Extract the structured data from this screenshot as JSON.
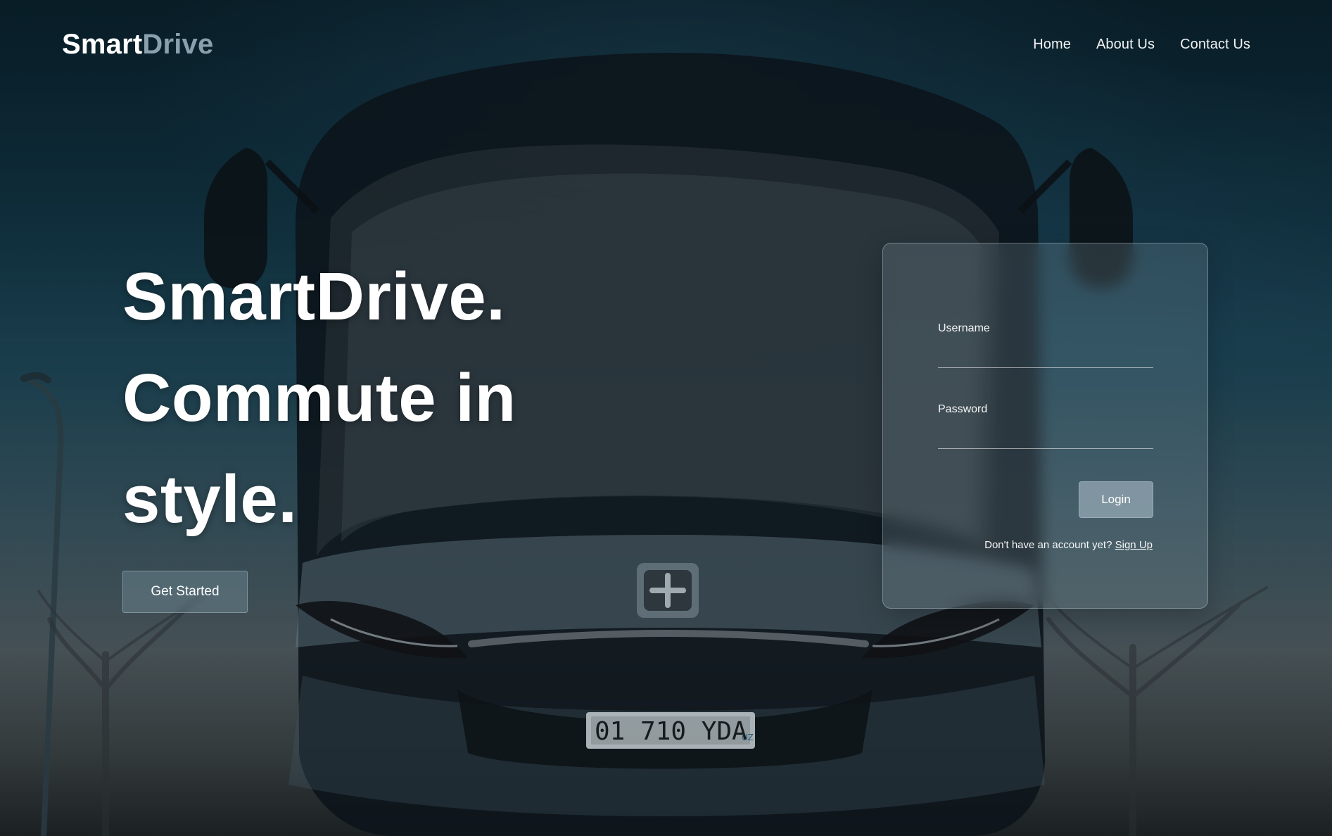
{
  "app": {
    "brand": {
      "primary": "Smart",
      "accent": "Drive"
    },
    "nav": {
      "items": [
        {
          "label": "Home"
        },
        {
          "label": "About Us"
        },
        {
          "label": "Contact Us"
        }
      ]
    }
  },
  "hero": {
    "lines": [
      "SmartDrive.",
      "Commute in",
      "style."
    ],
    "cta_label": "Get Started"
  },
  "login": {
    "username_label": "Username",
    "username_value": "",
    "password_label": "Password",
    "password_value": "",
    "login_button": "Login",
    "signup_prompt": "Don't have an account yet?",
    "signup_link": "Sign Up"
  },
  "photo": {
    "license_plate": "01 710 YDA",
    "plate_country": "UZ"
  },
  "theme": {
    "text": "#ffffff",
    "brand_accent": "#8aa0ad",
    "glass_fill": "#aac1cd",
    "cta_fill": "#829eab"
  }
}
